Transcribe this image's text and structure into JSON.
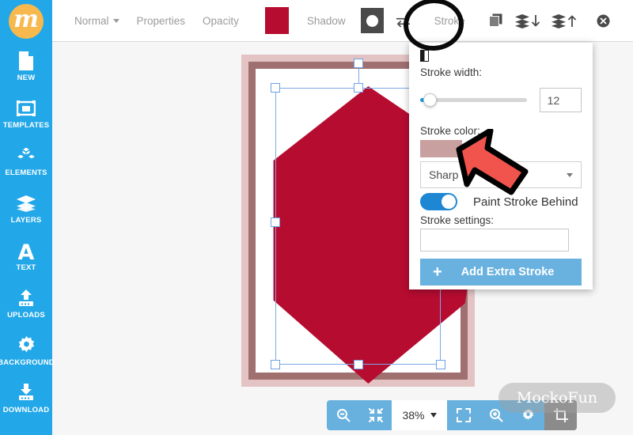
{
  "app": {
    "logo_letter": "m",
    "watermark": "MockoFun"
  },
  "sidebar": {
    "items": [
      {
        "label": "NEW",
        "icon": "page-icon"
      },
      {
        "label": "TEMPLATES",
        "icon": "templates-icon"
      },
      {
        "label": "ELEMENTS",
        "icon": "elements-icon"
      },
      {
        "label": "LAYERS",
        "icon": "layers-icon"
      },
      {
        "label": "TEXT",
        "icon": "text-icon"
      },
      {
        "label": "UPLOADS",
        "icon": "uploads-icon"
      },
      {
        "label": "BACKGROUND",
        "icon": "gear-icon"
      },
      {
        "label": "DOWNLOAD",
        "icon": "download-icon"
      }
    ]
  },
  "toolbar": {
    "blend_mode": "Normal",
    "properties_label": "Properties",
    "opacity_label": "Opacity",
    "fill_color": "#b60c30",
    "shadow_label": "Shadow",
    "shadow_color": "#4a4a4a",
    "flip_icon": "flip-horizontal-icon",
    "stroke_label": "Stroke",
    "duplicate_icon": "duplicate-icon",
    "send-backward_icon": "layer-down-icon",
    "bring-forward_icon": "layer-up-icon",
    "delete_icon": "delete-circle-icon"
  },
  "stroke_panel": {
    "glyph_icon": "half-filled-rect-icon",
    "width_label": "Stroke width:",
    "width_value": "12",
    "slider_percent": 6,
    "color_label": "Stroke color:",
    "color_value": "#c9a0a0",
    "join_selected": "Sharp",
    "paint_behind_label": "Paint Stroke Behind",
    "paint_behind_on": true,
    "settings_label": "Stroke settings:",
    "settings_value": "",
    "add_stroke_label": "Add Extra Stroke",
    "add_stroke_plus": "+"
  },
  "zoombar": {
    "zoom_out_icon": "zoom-out-icon",
    "fit_icon": "fit-screen-icon",
    "zoom_value": "38%",
    "fullscreen_icon": "fullscreen-icon",
    "zoom_in_icon": "zoom-in-icon",
    "settings_icon": "gear-icon",
    "crop_icon": "crop-icon"
  },
  "canvas": {
    "shape_fill": "#b60c30",
    "frame_outer_color": "#e3c3c3",
    "frame_inner_color": "#a07070",
    "background": "#f6f6f6"
  },
  "annotations": {
    "circle_target": "Stroke",
    "arrow_target": "stroke-color-swatch"
  }
}
